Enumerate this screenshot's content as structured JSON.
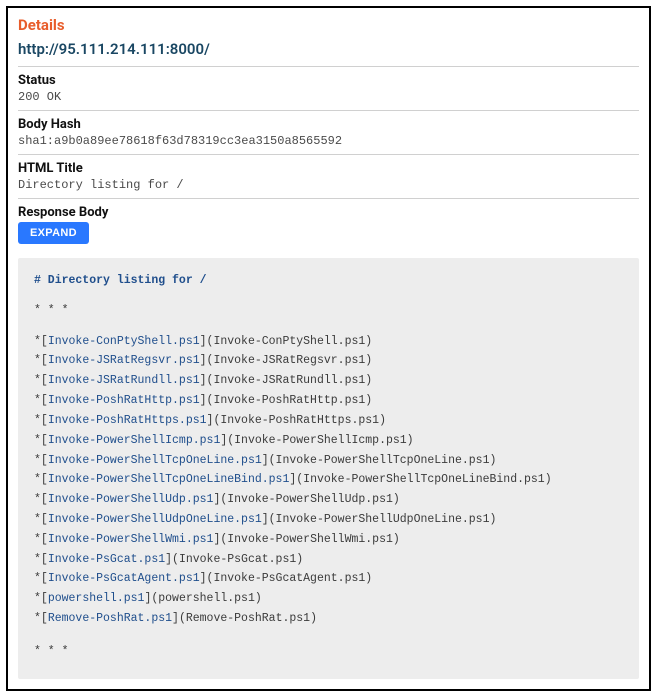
{
  "header": {
    "title": "Details",
    "url": "http://95.111.214.111:8000/"
  },
  "status": {
    "label": "Status",
    "value": "200 OK"
  },
  "body_hash": {
    "label": "Body Hash",
    "value": "sha1:a9b0a89ee78618f63d78319cc3ea3150a8565592"
  },
  "html_title": {
    "label": "HTML Title",
    "value": "Directory listing for /"
  },
  "response_body": {
    "label": "Response Body",
    "expand_label": "EXPAND"
  },
  "listing": {
    "heading": "# Directory listing for /",
    "separator": "* * *",
    "files": [
      "Invoke-ConPtyShell.ps1",
      "Invoke-JSRatRegsvr.ps1",
      "Invoke-JSRatRundll.ps1",
      "Invoke-PoshRatHttp.ps1",
      "Invoke-PoshRatHttps.ps1",
      "Invoke-PowerShellIcmp.ps1",
      "Invoke-PowerShellTcpOneLine.ps1",
      "Invoke-PowerShellTcpOneLineBind.ps1",
      "Invoke-PowerShellUdp.ps1",
      "Invoke-PowerShellUdpOneLine.ps1",
      "Invoke-PowerShellWmi.ps1",
      "Invoke-PsGcat.ps1",
      "Invoke-PsGcatAgent.ps1",
      "powershell.ps1",
      "Remove-PoshRat.ps1"
    ]
  }
}
